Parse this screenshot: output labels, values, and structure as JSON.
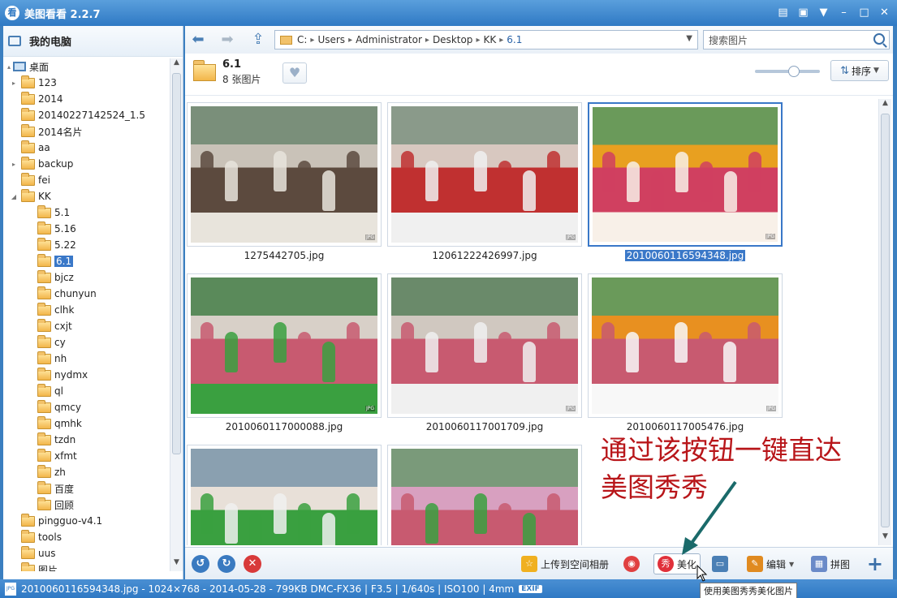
{
  "window": {
    "title": "美图看看 2.2.7",
    "app_icon": "看",
    "controls": [
      "chat-icon",
      "minimize-to-tray-icon",
      "skin-icon",
      "minimize-icon",
      "maximize-icon",
      "close-icon"
    ]
  },
  "sidebar": {
    "header": "我的电脑",
    "tree": [
      {
        "label": "桌面",
        "level": 0,
        "type": "desktop",
        "arrow": "▴"
      },
      {
        "label": "123",
        "level": 1,
        "arrow": "▸"
      },
      {
        "label": "2014",
        "level": 1,
        "arrow": ""
      },
      {
        "label": "20140227142524_1.5",
        "level": 1,
        "arrow": ""
      },
      {
        "label": "2014名片",
        "level": 1,
        "arrow": ""
      },
      {
        "label": "aa",
        "level": 1,
        "arrow": ""
      },
      {
        "label": "backup",
        "level": 1,
        "arrow": "▸"
      },
      {
        "label": "fei",
        "level": 1,
        "arrow": ""
      },
      {
        "label": "KK",
        "level": 1,
        "arrow": "◢"
      },
      {
        "label": "5.1",
        "level": 2,
        "arrow": ""
      },
      {
        "label": "5.16",
        "level": 2,
        "arrow": ""
      },
      {
        "label": "5.22",
        "level": 2,
        "arrow": ""
      },
      {
        "label": "6.1",
        "level": 2,
        "arrow": "",
        "selected": true
      },
      {
        "label": "bjcz",
        "level": 2,
        "arrow": ""
      },
      {
        "label": "chunyun",
        "level": 2,
        "arrow": ""
      },
      {
        "label": "clhk",
        "level": 2,
        "arrow": ""
      },
      {
        "label": "cxjt",
        "level": 2,
        "arrow": ""
      },
      {
        "label": "cy",
        "level": 2,
        "arrow": ""
      },
      {
        "label": "nh",
        "level": 2,
        "arrow": ""
      },
      {
        "label": "nydmx",
        "level": 2,
        "arrow": ""
      },
      {
        "label": "ql",
        "level": 2,
        "arrow": ""
      },
      {
        "label": "qmcy",
        "level": 2,
        "arrow": ""
      },
      {
        "label": "qmhk",
        "level": 2,
        "arrow": ""
      },
      {
        "label": "tzdn",
        "level": 2,
        "arrow": ""
      },
      {
        "label": "xfmt",
        "level": 2,
        "arrow": ""
      },
      {
        "label": "zh",
        "level": 2,
        "arrow": ""
      },
      {
        "label": "百度",
        "level": 2,
        "arrow": ""
      },
      {
        "label": "回顾",
        "level": 2,
        "arrow": ""
      },
      {
        "label": "pingguo-v4.1",
        "level": 1,
        "arrow": ""
      },
      {
        "label": "tools",
        "level": 1,
        "arrow": ""
      },
      {
        "label": "uus",
        "level": 1,
        "arrow": ""
      },
      {
        "label": "图片",
        "level": 1,
        "arrow": ""
      }
    ]
  },
  "toolbar": {
    "breadcrumbs": [
      "C:",
      "Users",
      "Administrator",
      "Desktop",
      "KK",
      "6.1"
    ],
    "search_placeholder": "搜索图片"
  },
  "folder": {
    "name": "6.1",
    "count": "8 张图片",
    "sort_label": "排序",
    "zoom_level": 0.6
  },
  "thumbnails": [
    {
      "file": "1275442705.jpg",
      "palette": [
        "#7a8f7a",
        "#c9c2b8",
        "#5c4a3e",
        "#e8e4dc"
      ],
      "selected": false
    },
    {
      "file": "12061222426997.jpg",
      "palette": [
        "#8a9a8a",
        "#d8c8c0",
        "#c03030",
        "#f0f0f0"
      ],
      "selected": false
    },
    {
      "file": "2010060116594348.jpg",
      "palette": [
        "#6a9a5a",
        "#e8a020",
        "#d04060",
        "#f8f0e8"
      ],
      "selected": true
    },
    {
      "file": "2010060117000088.jpg",
      "palette": [
        "#5a8a5a",
        "#d8d0c8",
        "#c85a70",
        "#3aa040"
      ],
      "selected": false
    },
    {
      "file": "2010060117001709.jpg",
      "palette": [
        "#6a8a6a",
        "#d0c8c0",
        "#c85a70",
        "#f0f0f0"
      ],
      "selected": false
    },
    {
      "file": "2010060117005476.jpg",
      "palette": [
        "#6a9a5a",
        "#e89020",
        "#c85a70",
        "#f8f8f8"
      ],
      "selected": false
    },
    {
      "file": "",
      "palette": [
        "#8aa0b0",
        "#e8e0d8",
        "#3aa040",
        "#f0f0f0"
      ],
      "selected": false
    },
    {
      "file": "",
      "palette": [
        "#7a9a7a",
        "#d8a0c0",
        "#c85a70",
        "#3aa040"
      ],
      "selected": false
    }
  ],
  "bottombar": {
    "upload_label": "上传到空间相册",
    "meihua_label": "美化",
    "edit_label": "编辑",
    "collage_label": "拼图",
    "meihua_icon_text": "秀"
  },
  "tooltip": "使用美图秀秀美化图片",
  "statusbar": {
    "text": "2010060116594348.jpg - 1024×768 - 2014-05-28 - 799KB  DMC-FX36 | F3.5 | 1/640s | ISO100 | 4mm",
    "exif": "EXIF"
  },
  "annotation": {
    "line1": "通过该按钮一键直达",
    "line2": "美图秀秀"
  },
  "colors": {
    "accent": "#3a78c8",
    "annotation": "#b8161a",
    "arrow": "#1a6a6a"
  }
}
